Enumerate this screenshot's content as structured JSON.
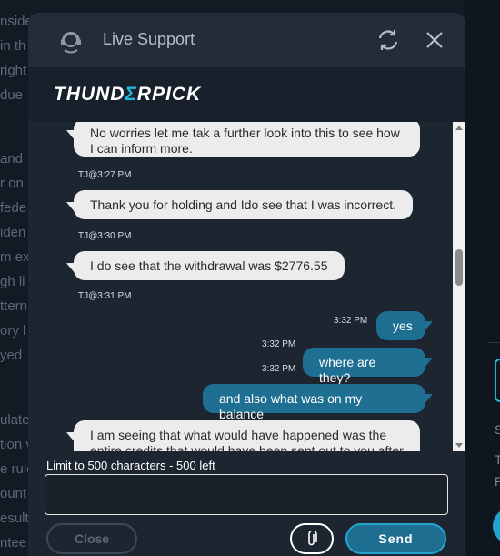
{
  "background": {
    "left_fragments": [
      "nside",
      "in th",
      "right",
      "due",
      "and",
      "r on",
      "fede",
      "iden",
      "m ex",
      "gh li",
      "ttern",
      "ory l",
      "yed",
      "ulate",
      "tion v",
      "e rule",
      "ount",
      "esult",
      "ntee"
    ],
    "right_fragments": [
      "S",
      "T",
      "P"
    ]
  },
  "header": {
    "title": "Live Support"
  },
  "brand": {
    "logo_start": "THUND",
    "logo_accent": "Σ",
    "logo_end": "RPICK"
  },
  "messages": [
    {
      "from": "agent",
      "text": "No worries let me tak a further look into this to see how I can inform more.",
      "meta": "TJ@3:27 PM"
    },
    {
      "from": "agent",
      "text": "Thank you for holding and Ido see that I was incorrect.",
      "meta": "TJ@3:30 PM"
    },
    {
      "from": "agent",
      "text": "I do see that the withdrawal was $2776.55",
      "meta": "TJ@3:31 PM"
    },
    {
      "from": "user",
      "text": "yes",
      "meta": "3:32 PM"
    },
    {
      "from": "user",
      "text": "where are they?",
      "meta": "3:32 PM"
    },
    {
      "from": "user",
      "text": "and also what was on my balance",
      "meta": "3:32 PM"
    },
    {
      "from": "agent",
      "text": "I am seeing that what would have happened was the entire credits that would have been sent out to you after",
      "meta": ""
    }
  ],
  "composer": {
    "limit_text": "Limit to 500 characters - 500 left",
    "input_value": "",
    "input_placeholder": "",
    "close_label": "Close",
    "send_label": "Send"
  },
  "colors": {
    "accent": "#22b5e2",
    "user_bubble": "#1f6f93",
    "agent_bubble": "#ececec",
    "modal_bg": "#1c2530"
  }
}
